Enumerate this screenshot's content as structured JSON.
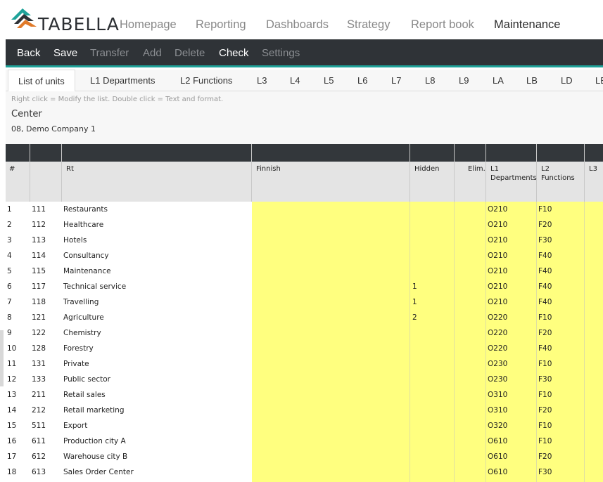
{
  "logo": {
    "text": "TABELLA"
  },
  "nav": [
    {
      "label": "Homepage",
      "active": false
    },
    {
      "label": "Reporting",
      "active": false
    },
    {
      "label": "Dashboards",
      "active": false
    },
    {
      "label": "Strategy",
      "active": false
    },
    {
      "label": "Report book",
      "active": false
    },
    {
      "label": "Maintenance",
      "active": true
    }
  ],
  "toolbar": [
    {
      "label": "Back",
      "enabled": true
    },
    {
      "label": "Save",
      "enabled": true
    },
    {
      "label": "Transfer",
      "enabled": false
    },
    {
      "label": "Add",
      "enabled": false
    },
    {
      "label": "Delete",
      "enabled": false
    },
    {
      "label": "Check",
      "enabled": true
    },
    {
      "label": "Settings",
      "enabled": false
    }
  ],
  "tabs": [
    "List of units",
    "L1 Departments",
    "L2 Functions",
    "L3",
    "L4",
    "L5",
    "L6",
    "L7",
    "L8",
    "L9",
    "LA",
    "LB",
    "LD",
    "LE"
  ],
  "info": {
    "hint": "Right click = Modify the list. Double click = Text and format.",
    "center": "Center",
    "company": "08, Demo Company 1"
  },
  "columns": [
    "#",
    "",
    "Rt",
    "Finnish",
    "Hidden",
    "Elim.",
    "L1\nDepartments",
    "L2\nFunctions",
    "L3"
  ],
  "rows": [
    {
      "n": "1",
      "code": "111",
      "name": "Restaurants",
      "hidden": "",
      "l1": "O210",
      "l2": "F10"
    },
    {
      "n": "2",
      "code": "112",
      "name": "Healthcare",
      "hidden": "",
      "l1": "O210",
      "l2": "F20"
    },
    {
      "n": "3",
      "code": "113",
      "name": "Hotels",
      "hidden": "",
      "l1": "O210",
      "l2": "F30"
    },
    {
      "n": "4",
      "code": "114",
      "name": "Consultancy",
      "hidden": "",
      "l1": "O210",
      "l2": "F40"
    },
    {
      "n": "5",
      "code": "115",
      "name": "Maintenance",
      "hidden": "",
      "l1": "O210",
      "l2": "F40"
    },
    {
      "n": "6",
      "code": "117",
      "name": "Technical service",
      "hidden": "1",
      "l1": "O210",
      "l2": "F40"
    },
    {
      "n": "7",
      "code": "118",
      "name": "Travelling",
      "hidden": "1",
      "l1": "O210",
      "l2": "F40"
    },
    {
      "n": "8",
      "code": "121",
      "name": "Agriculture",
      "hidden": "2",
      "l1": "O220",
      "l2": "F10"
    },
    {
      "n": "9",
      "code": "122",
      "name": "Chemistry",
      "hidden": "",
      "l1": "O220",
      "l2": "F20"
    },
    {
      "n": "10",
      "code": "128",
      "name": "Forestry",
      "hidden": "",
      "l1": "O220",
      "l2": "F40"
    },
    {
      "n": "11",
      "code": "131",
      "name": "Private",
      "hidden": "",
      "l1": "O230",
      "l2": "F10"
    },
    {
      "n": "12",
      "code": "133",
      "name": "Public sector",
      "hidden": "",
      "l1": "O230",
      "l2": "F30"
    },
    {
      "n": "13",
      "code": "211",
      "name": "Retail sales",
      "hidden": "",
      "l1": "O310",
      "l2": "F10"
    },
    {
      "n": "14",
      "code": "212",
      "name": "Retail marketing",
      "hidden": "",
      "l1": "O310",
      "l2": "F20"
    },
    {
      "n": "15",
      "code": "511",
      "name": "Export",
      "hidden": "",
      "l1": "O320",
      "l2": "F10"
    },
    {
      "n": "16",
      "code": "611",
      "name": "Production city A",
      "hidden": "",
      "l1": "O610",
      "l2": "F10"
    },
    {
      "n": "17",
      "code": "612",
      "name": "Warehouse city B",
      "hidden": "",
      "l1": "O610",
      "l2": "F20"
    },
    {
      "n": "18",
      "code": "613",
      "name": "Sales Order Center",
      "hidden": "",
      "l1": "O610",
      "l2": "F30"
    }
  ],
  "colors": {
    "accent": "#1fa39a",
    "toolbar": "#2f3337",
    "editable": "#ffff7f"
  }
}
